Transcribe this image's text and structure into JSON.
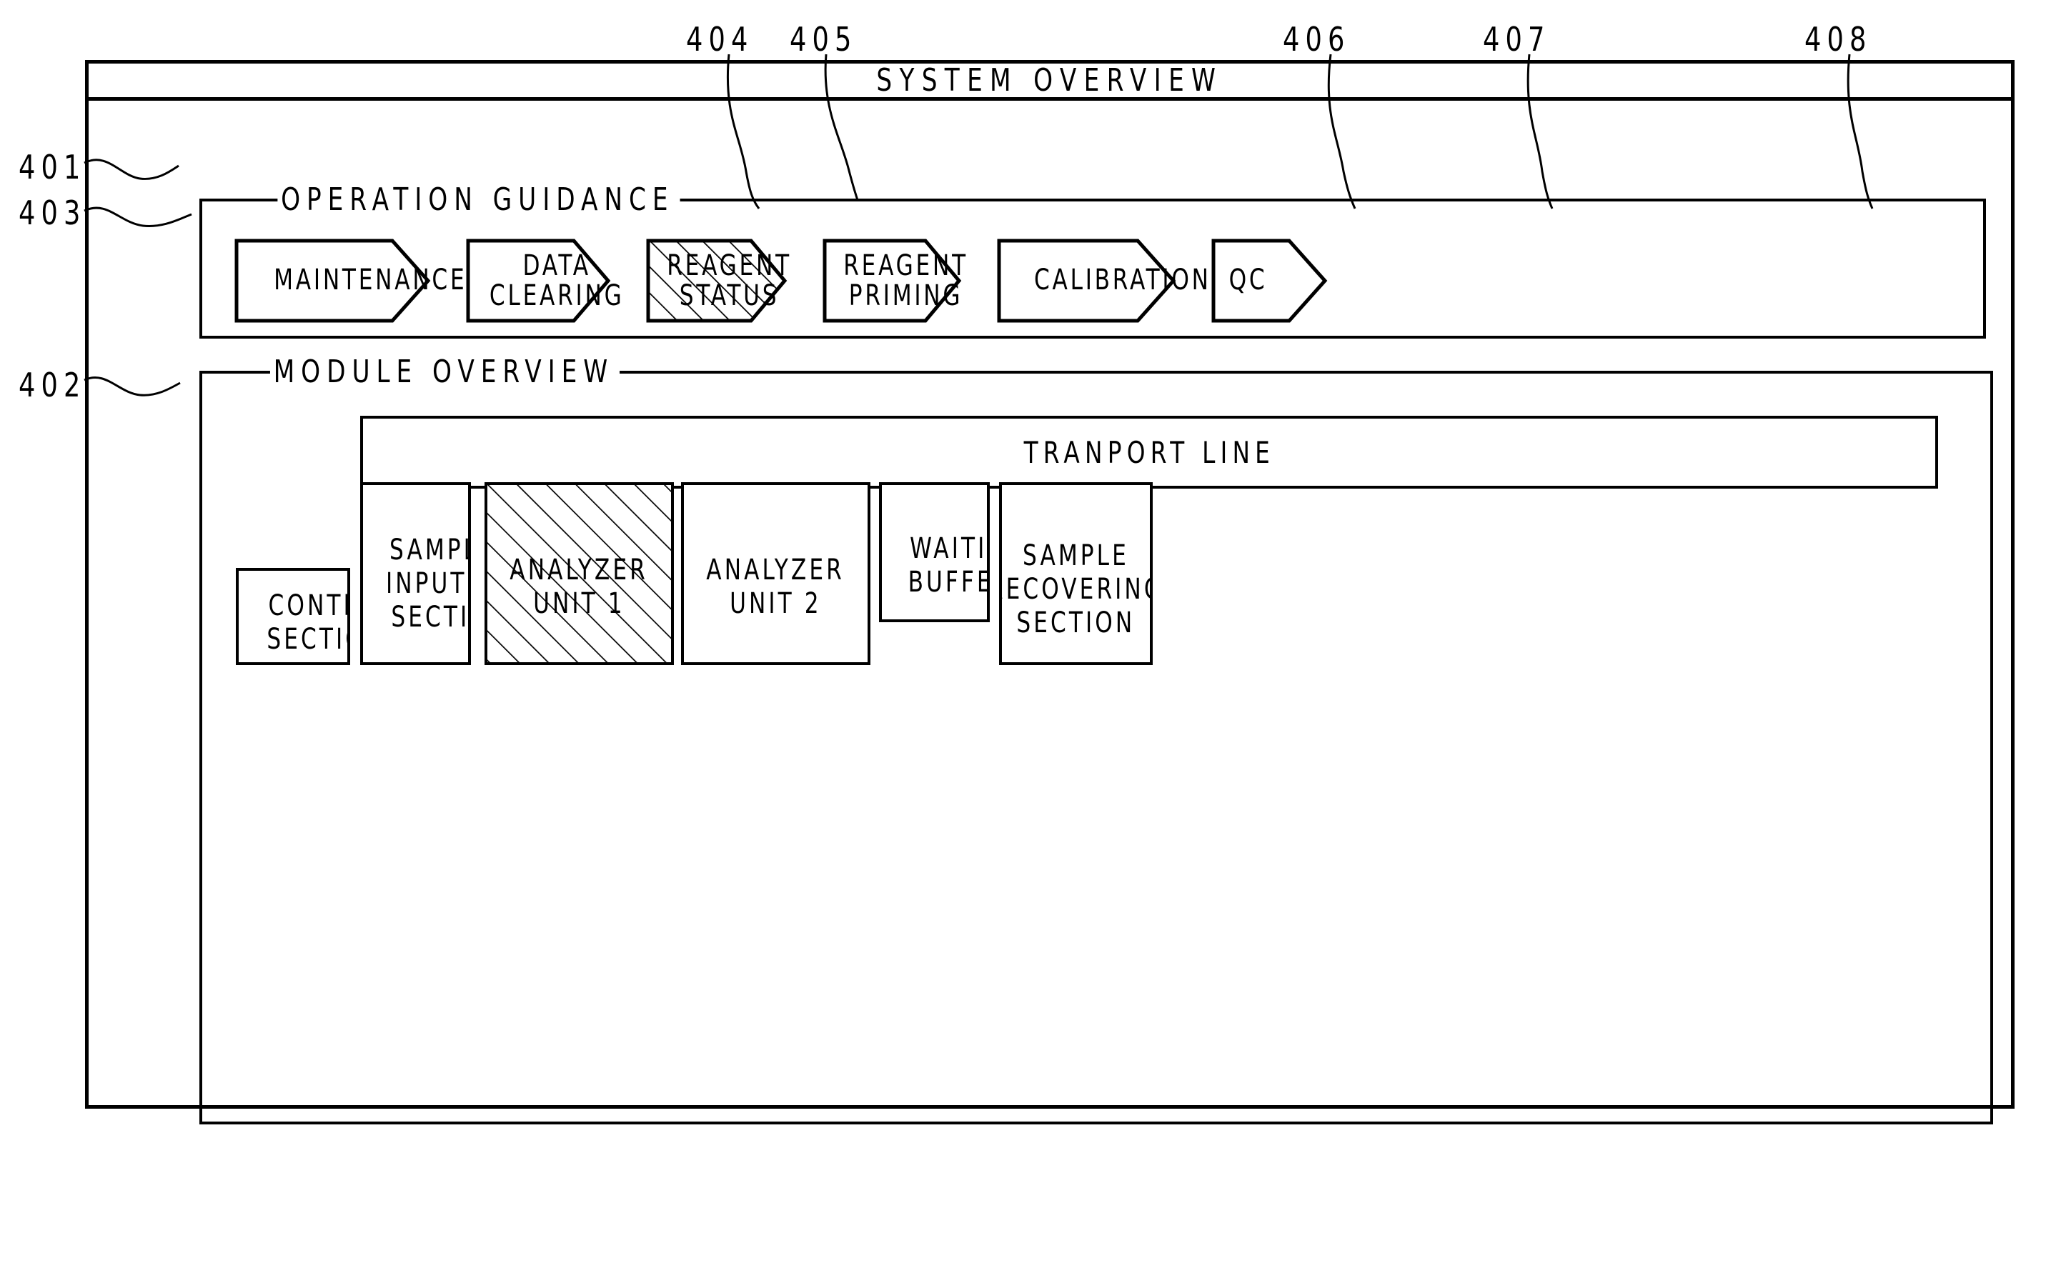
{
  "window": {
    "title": "SYSTEM OVERVIEW"
  },
  "operation_guidance": {
    "legend": "OPERATION GUIDANCE",
    "buttons": [
      {
        "id": "maintenance",
        "lines": [
          "MAINTENANCE"
        ],
        "selected": false,
        "ref": "403"
      },
      {
        "id": "data-clearing",
        "lines": [
          "DATA",
          "CLEARING"
        ],
        "selected": false,
        "ref": "404"
      },
      {
        "id": "reagent-status",
        "lines": [
          "REAGENT",
          "STATUS"
        ],
        "selected": true,
        "ref": "405"
      },
      {
        "id": "reagent-priming",
        "lines": [
          "REAGENT",
          "PRIMING"
        ],
        "selected": false,
        "ref": "406"
      },
      {
        "id": "calibration",
        "lines": [
          "CALIBRATION"
        ],
        "selected": false,
        "ref": "407"
      },
      {
        "id": "qc",
        "lines": [
          "QC"
        ],
        "selected": false,
        "ref": "408"
      }
    ]
  },
  "module_overview": {
    "legend": "MODULE OVERVIEW",
    "transport_line": "TRANPORT LINE",
    "modules": [
      {
        "id": "control-section",
        "lines": [
          "CONTROL",
          "SECTION"
        ],
        "selected": false
      },
      {
        "id": "sample-input-section",
        "lines": [
          "SAMPLE",
          "INPUT",
          "SECTION"
        ],
        "selected": false
      },
      {
        "id": "analyzer-unit-1",
        "lines": [
          "ANALYZER",
          "UNIT 1"
        ],
        "selected": true
      },
      {
        "id": "analyzer-unit-2",
        "lines": [
          "ANALYZER",
          "UNIT 2"
        ],
        "selected": false
      },
      {
        "id": "waiting-buffer",
        "lines": [
          "WAITING",
          "BUFFER"
        ],
        "selected": false
      },
      {
        "id": "sample-recovering-section",
        "lines": [
          "SAMPLE",
          "RECOVERING",
          "SECTION"
        ],
        "selected": false
      }
    ]
  },
  "reference_numerals": {
    "r401": "401",
    "r402": "402",
    "r403": "403",
    "r404": "404",
    "r405": "405",
    "r406": "406",
    "r407": "407",
    "r408": "408"
  },
  "colors": {
    "ink": "#000000",
    "paper": "#ffffff"
  }
}
